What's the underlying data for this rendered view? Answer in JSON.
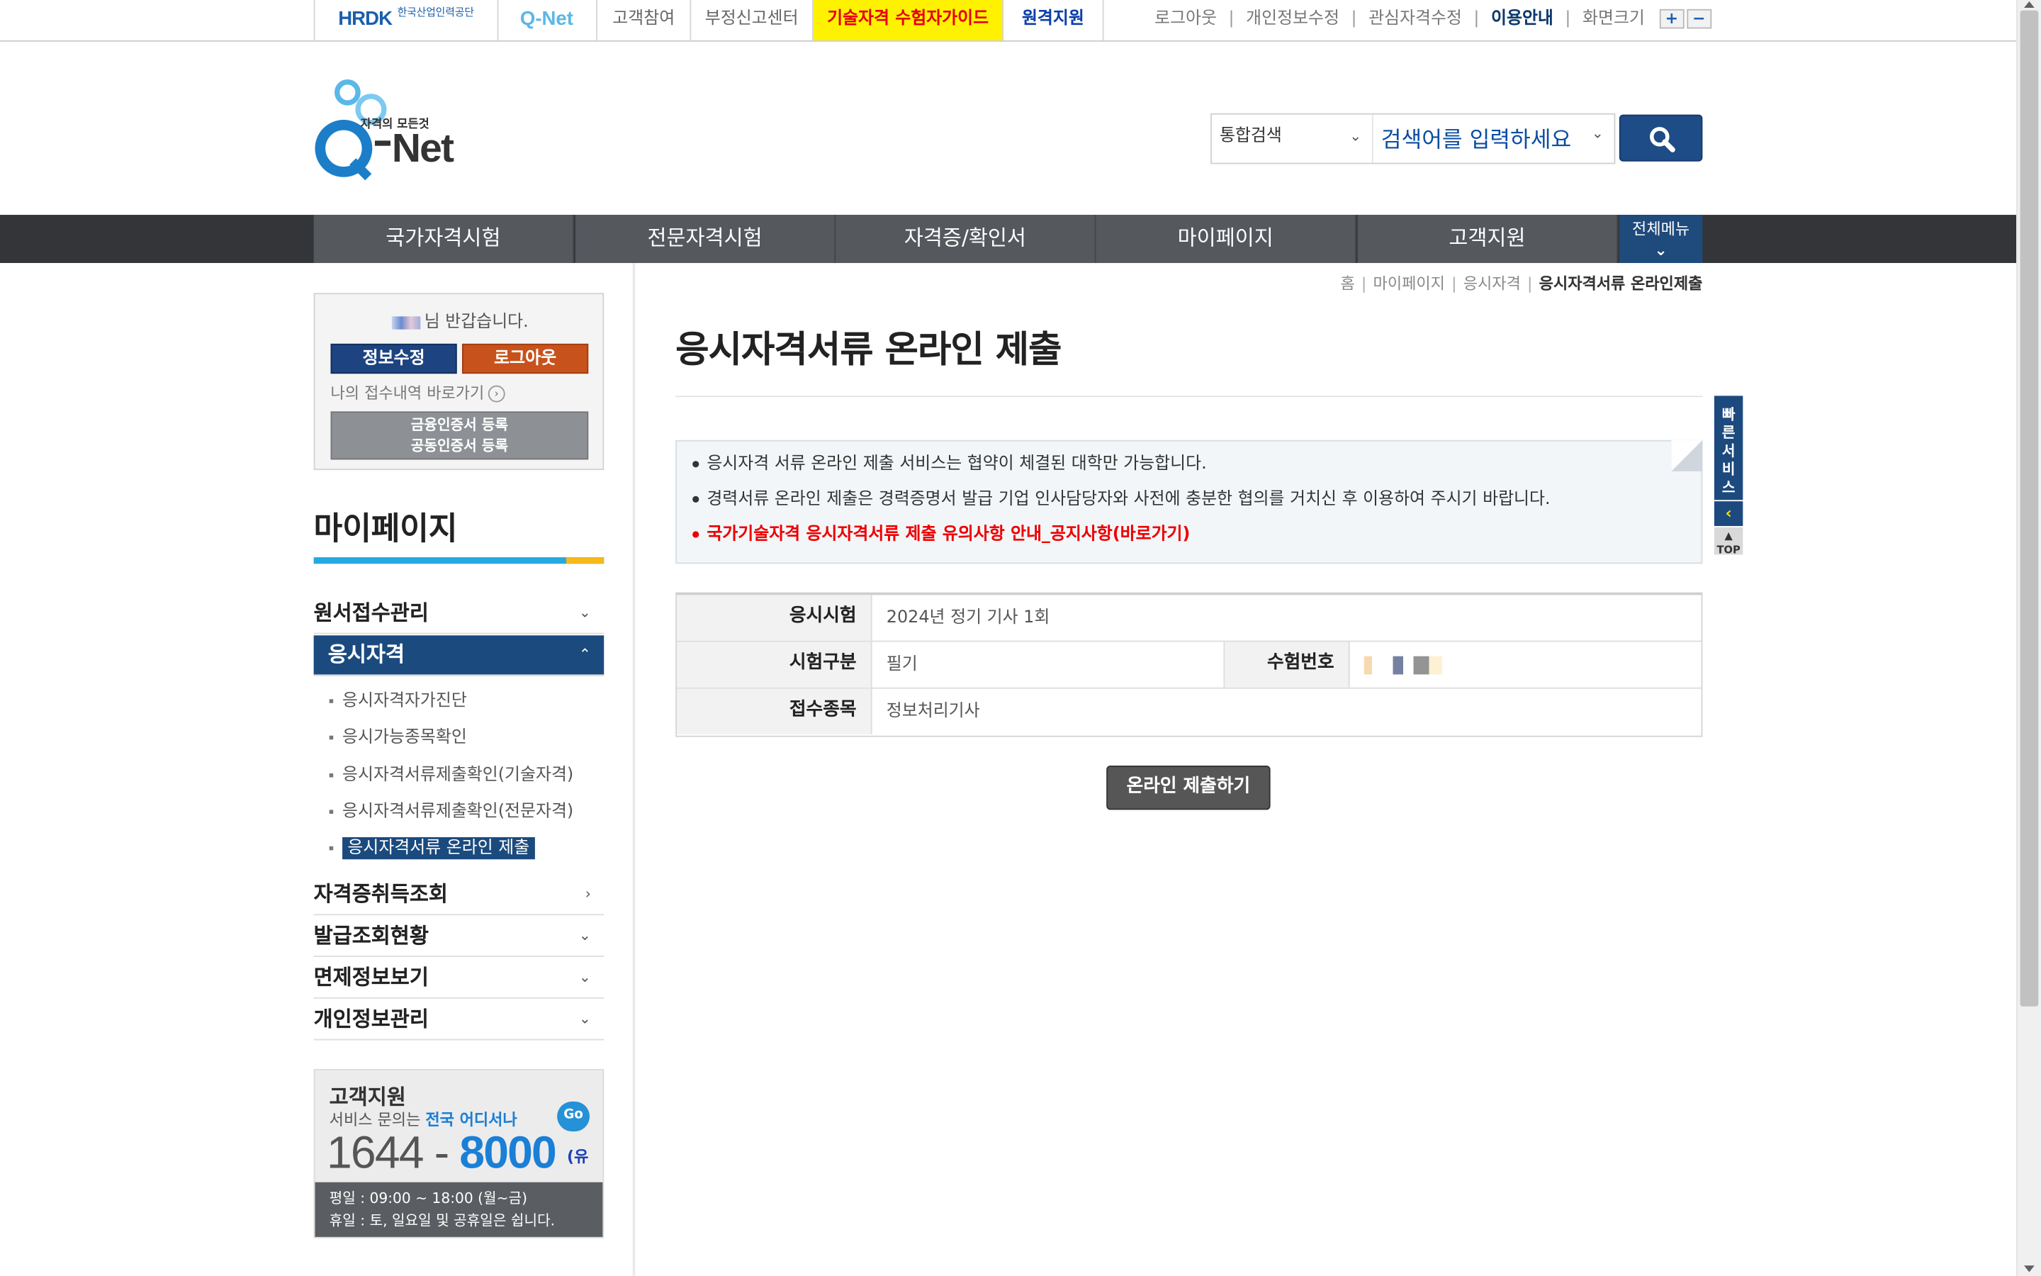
{
  "topbar": {
    "hrdk_logo": "HRDK",
    "hrdk_name": "한국산업인력공단",
    "qnet_small_logo": "Q-Net",
    "customer_participation": "고객참여",
    "report_center": "부정신고센터",
    "exam_guide": "기술자격 수험자가이드",
    "remote_support": "원격지원",
    "logout": "로그아웃",
    "edit_info": "개인정보수정",
    "interest_edit": "관심자격수정",
    "usage_guide": "이용안내",
    "screen_size": "화면크기",
    "zoom_in": "+",
    "zoom_out": "−"
  },
  "header": {
    "logo_tagline": "자격의 모든것",
    "logo_name": "Q-Net",
    "search_scope": "통합검색",
    "search_placeholder": "검색어를 입력하세요"
  },
  "gnb": {
    "items": [
      "국가자격시험",
      "전문자격시험",
      "자격증/확인서",
      "마이페이지",
      "고객지원"
    ],
    "all_menu": "전체메뉴"
  },
  "sidebar": {
    "welcome": "님 반갑습니다.",
    "edit_button": "정보수정",
    "logout_button": "로그아웃",
    "my_receipt": "나의 접수내역 바로가기",
    "cert_line1": "금융인증서 등록",
    "cert_line2": "공동인증서 등록",
    "title": "마이페이지",
    "menu": [
      {
        "label": "원서접수관리",
        "arrow": "⌄"
      },
      {
        "label": "응시자격",
        "arrow": "⌃"
      },
      {
        "label": "자격증취득조회",
        "arrow": "›"
      },
      {
        "label": "발급조회현황",
        "arrow": "⌄"
      },
      {
        "label": "면제정보보기",
        "arrow": "⌄"
      },
      {
        "label": "개인정보관리",
        "arrow": "⌄"
      }
    ],
    "submenu": [
      "응시자격자가진단",
      "응시가능종목확인",
      "응시자격서류제출확인(기술자격)",
      "응시자격서류제출확인(전문자격)",
      "응시자격서류 온라인 제출"
    ],
    "customer_support": {
      "title": "고객지원",
      "desc_prefix": "서비스 문의는 ",
      "desc_highlight": "전국 어디서나",
      "go": "Go",
      "phone_prefix": "1644 - ",
      "phone_main": "8000",
      "paid": "(유료)",
      "hours_weekday": "평일 : 09:00 ~ 18:00 (월~금)",
      "hours_holiday": "휴일 : 토, 일요일 및 공휴일은 쉽니다."
    }
  },
  "breadcrumb": [
    "홈",
    "마이페이지",
    "응시자격",
    "응시자격서류 온라인제출"
  ],
  "main": {
    "title": "응시자격서류 온라인 제출",
    "notices": [
      "응시자격 서류 온라인 제출 서비스는 협약이 체결된 대학만 가능합니다.",
      "경력서류 온라인 제출은 경력증명서 발급 기업 인사담당자와 사전에 충분한 협의를 거치신 후 이용하여 주시기 바랍니다.",
      "국가기술자격 응시자격서류 제출 유의사항 안내_공지사항(바로가기)"
    ],
    "table": {
      "exam_label": "응시시험",
      "exam_value": "2024년 정기 기사 1회",
      "type_label": "시험구분",
      "type_value": "필기",
      "number_label": "수험번호",
      "field_label": "접수종목",
      "field_value": "정보처리기사"
    },
    "submit_button": "온라인 제출하기"
  },
  "quick": {
    "label": "빠른서비스",
    "arrow": "‹",
    "top": "TOP"
  }
}
